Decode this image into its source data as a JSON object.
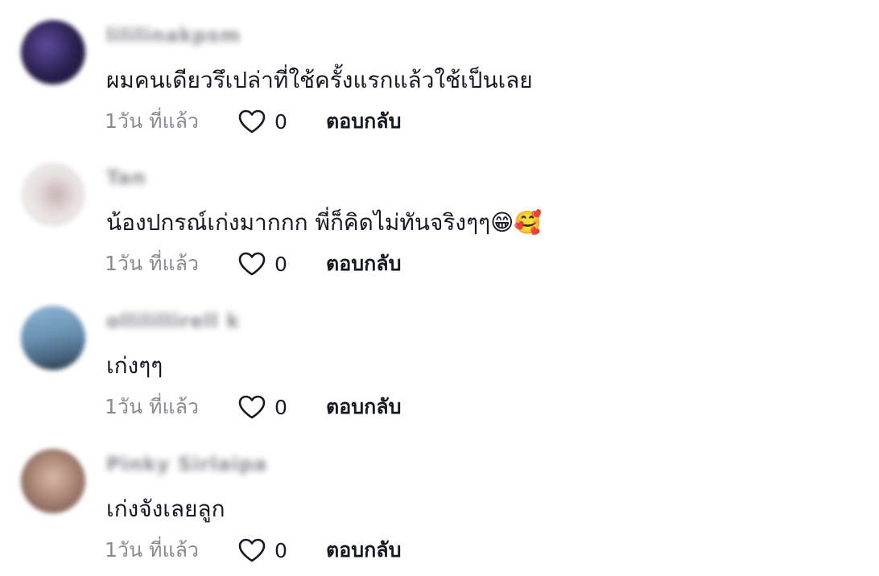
{
  "comments": [
    {
      "username": "lililinakpsm",
      "text": "ผมคนเดียวรึเปล่าที่ใช้ครั้งแรกแล้วใช้เป็นเลย",
      "time": "1วัน ที่แล้ว",
      "likes": "0",
      "reply": "ตอบกลับ",
      "avatar_colors": [
        "#2a1f4d",
        "#5d4a9c",
        "#1c1633"
      ]
    },
    {
      "username": "Tan",
      "text": "น้องปกรณ์เก่งมากกก พี่ก็คิดไม่ทันจริงๆๆ😁🥰",
      "time": "1วัน ที่แล้ว",
      "likes": "0",
      "reply": "ตอบกลับ",
      "avatar_colors": [
        "#f1eeee",
        "#c9b4b4",
        "#e8e2e2"
      ]
    },
    {
      "username": "ollilillirell k",
      "text": "เก่งๆๆ",
      "time": "1วัน ที่แล้ว",
      "likes": "0",
      "reply": "ตอบกลับ",
      "avatar_colors": [
        "#8fb6d6",
        "#4e6f8c",
        "#2d3a45"
      ]
    },
    {
      "username": "Pinky Sirlaipa",
      "text": "เก่งจังเลยลูก",
      "time": "1วัน ที่แล้ว",
      "likes": "0",
      "reply": "ตอบกลับ",
      "avatar_colors": [
        "#b08c7c",
        "#6b4a40",
        "#d9b8a8"
      ]
    }
  ]
}
